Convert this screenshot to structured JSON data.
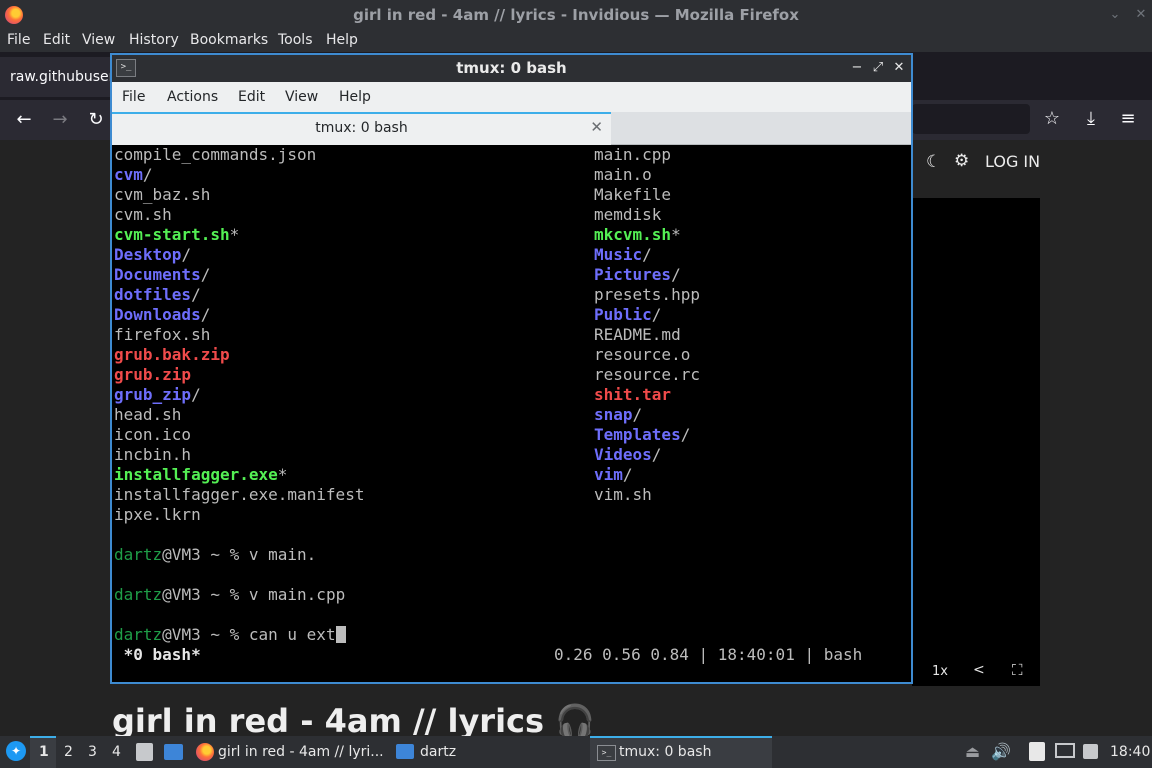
{
  "firefox": {
    "window_title": "girl in red - 4am // lyrics - Invidious — Mozilla Firefox",
    "menu": [
      "File",
      "Edit",
      "View",
      "History",
      "Bookmarks",
      "Tools",
      "Help"
    ],
    "tab_label": "raw.githubuser",
    "page": {
      "login_label": "LOG IN",
      "video_title": "girl in red - 4am // lyrics",
      "speed_label": "1x"
    }
  },
  "terminal": {
    "window_title": "tmux: 0 bash",
    "menu": [
      "File",
      "Actions",
      "Edit",
      "View",
      "Help"
    ],
    "tab_label": "tmux: 0 bash",
    "left_column": [
      {
        "name": "compile_commands.json",
        "suffix": "",
        "kind": "file"
      },
      {
        "name": "cvm",
        "suffix": "/",
        "kind": "dir"
      },
      {
        "name": "cvm_baz.sh",
        "suffix": "",
        "kind": "file"
      },
      {
        "name": "cvm.sh",
        "suffix": "",
        "kind": "file"
      },
      {
        "name": "cvm-start.sh",
        "suffix": "*",
        "kind": "exe"
      },
      {
        "name": "Desktop",
        "suffix": "/",
        "kind": "dir"
      },
      {
        "name": "Documents",
        "suffix": "/",
        "kind": "dir"
      },
      {
        "name": "dotfiles",
        "suffix": "/",
        "kind": "dir"
      },
      {
        "name": "Downloads",
        "suffix": "/",
        "kind": "dir"
      },
      {
        "name": "firefox.sh",
        "suffix": "",
        "kind": "file"
      },
      {
        "name": "grub.bak.zip",
        "suffix": "",
        "kind": "arc"
      },
      {
        "name": "grub.zip",
        "suffix": "",
        "kind": "arc"
      },
      {
        "name": "grub_zip",
        "suffix": "/",
        "kind": "dir"
      },
      {
        "name": "head.sh",
        "suffix": "",
        "kind": "file"
      },
      {
        "name": "icon.ico",
        "suffix": "",
        "kind": "file"
      },
      {
        "name": "incbin.h",
        "suffix": "",
        "kind": "file"
      },
      {
        "name": "installfagger.exe",
        "suffix": "*",
        "kind": "exe"
      },
      {
        "name": "installfagger.exe.manifest",
        "suffix": "",
        "kind": "file"
      },
      {
        "name": "ipxe.lkrn",
        "suffix": "",
        "kind": "file"
      }
    ],
    "right_column": [
      {
        "name": "main.cpp",
        "suffix": "",
        "kind": "file"
      },
      {
        "name": "main.o",
        "suffix": "",
        "kind": "file"
      },
      {
        "name": "Makefile",
        "suffix": "",
        "kind": "file"
      },
      {
        "name": "memdisk",
        "suffix": "",
        "kind": "file"
      },
      {
        "name": "mkcvm.sh",
        "suffix": "*",
        "kind": "exe"
      },
      {
        "name": "Music",
        "suffix": "/",
        "kind": "dir"
      },
      {
        "name": "Pictures",
        "suffix": "/",
        "kind": "dir"
      },
      {
        "name": "presets.hpp",
        "suffix": "",
        "kind": "file"
      },
      {
        "name": "Public",
        "suffix": "/",
        "kind": "dir"
      },
      {
        "name": "README.md",
        "suffix": "",
        "kind": "file"
      },
      {
        "name": "resource.o",
        "suffix": "",
        "kind": "file"
      },
      {
        "name": "resource.rc",
        "suffix": "",
        "kind": "file"
      },
      {
        "name": "shit.tar",
        "suffix": "",
        "kind": "arc"
      },
      {
        "name": "snap",
        "suffix": "/",
        "kind": "dir"
      },
      {
        "name": "Templates",
        "suffix": "/",
        "kind": "dir"
      },
      {
        "name": "Videos",
        "suffix": "/",
        "kind": "dir"
      },
      {
        "name": "vim",
        "suffix": "/",
        "kind": "dir"
      },
      {
        "name": "vim.sh",
        "suffix": "",
        "kind": "file"
      }
    ],
    "prompt_user": "dartz",
    "prompt_host": "@VM3 ~ % ",
    "commands": [
      "v main.",
      "v main.cpp",
      "can u ext"
    ],
    "status_left": " *0 bash*",
    "status_right": "0.26 0.56 0.84 | 18:40:01 | bash"
  },
  "taskbar": {
    "workspaces": [
      "1",
      "2",
      "3",
      "4"
    ],
    "firefox_label": "girl in red - 4am // lyri...",
    "folder_label": "dartz",
    "terminal_label": "tmux: 0 bash",
    "clock": "18:40"
  },
  "colors": {
    "dir": "#6e6efb",
    "exe": "#54f054",
    "arc": "#f04b4b",
    "prompt_user": "#1f9f48",
    "window_border": "#3e8bd1"
  }
}
